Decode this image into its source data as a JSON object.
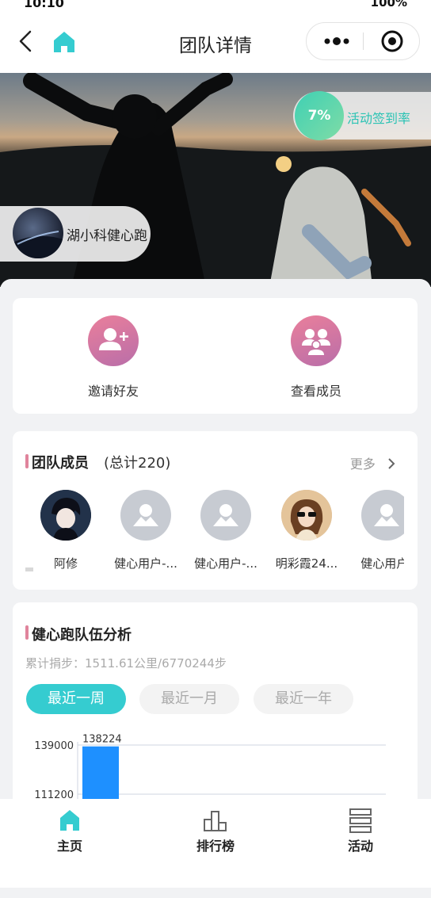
{
  "statusbar": {
    "time": "10:10",
    "battery": "100%"
  },
  "nav": {
    "title": "团队详情"
  },
  "banner": {
    "rate_value": "7%",
    "rate_label": "活动签到率",
    "team_name": "湖小科健心跑"
  },
  "actions": [
    {
      "label": "邀请好友",
      "icon": "add-user-icon"
    },
    {
      "label": "查看成员",
      "icon": "group-icon"
    }
  ],
  "members_section": {
    "title": "团队成员",
    "count": "(总计220)",
    "more": "更多",
    "members": [
      {
        "name": "阿修",
        "avatar": "anime-avatar"
      },
      {
        "name": "健心用户-...",
        "avatar": "default-avatar"
      },
      {
        "name": "健心用户-...",
        "avatar": "default-avatar"
      },
      {
        "name": "明彩霞24...",
        "avatar": "photo-avatar"
      },
      {
        "name": "健心用户-",
        "avatar": "default-avatar"
      }
    ]
  },
  "analysis": {
    "title": "健心跑队伍分析",
    "summary": "累计捐步：1511.61公里/6770244步",
    "segments": [
      "最近一周",
      "最近一月",
      "最近一年"
    ],
    "active_segment": "最近一周"
  },
  "chart_data": {
    "type": "bar",
    "title": "",
    "xlabel": "",
    "ylabel": "",
    "y_ticks": [
      139000,
      111200
    ],
    "ylim": [
      111200,
      139000
    ],
    "grid": true,
    "series": [
      {
        "values": [
          138224
        ],
        "labels": [
          "138224"
        ],
        "color": "#1e90ff"
      }
    ]
  },
  "tabbar": [
    {
      "label": "主页",
      "icon": "home-icon",
      "active": true
    },
    {
      "label": "排行榜",
      "icon": "bar-chart-icon",
      "active": false
    },
    {
      "label": "活动",
      "icon": "list-icon",
      "active": false
    }
  ],
  "colors": {
    "accent": "#35ccd0",
    "bar": "#1e90ff",
    "section_bar": "#e0849c"
  }
}
